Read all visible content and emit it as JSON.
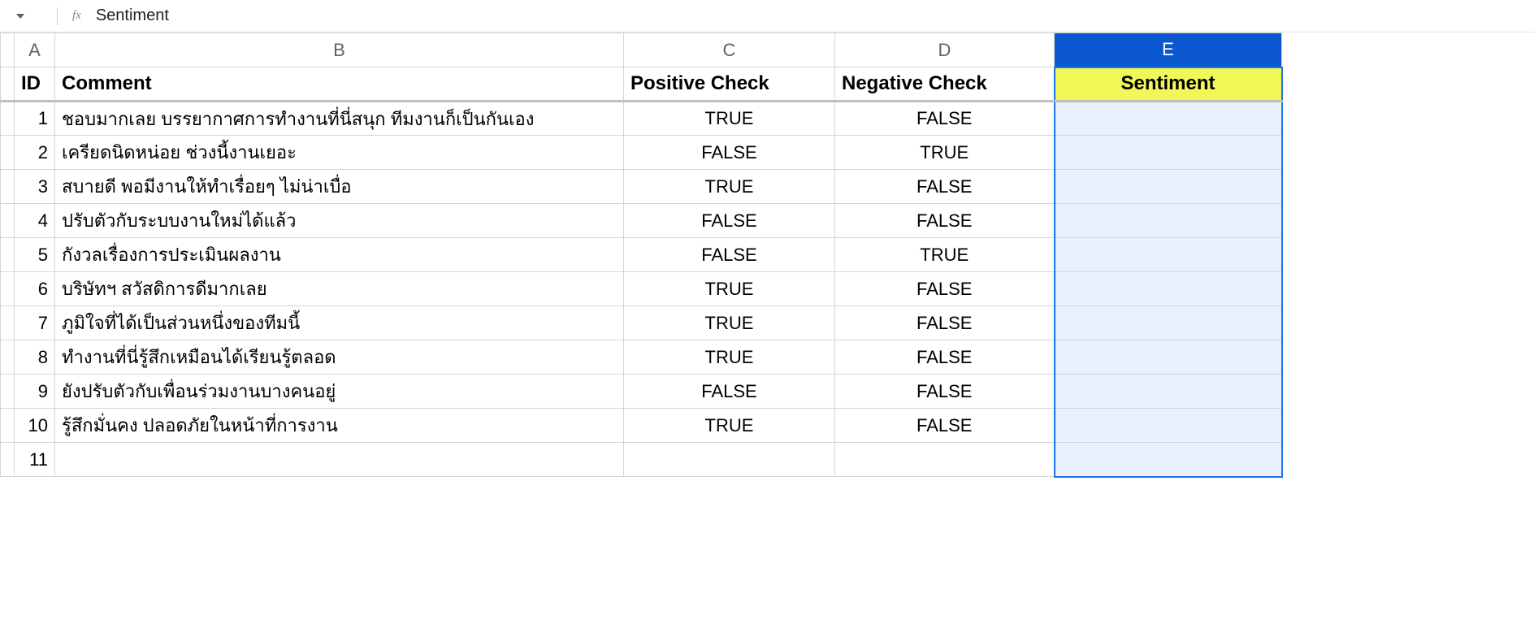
{
  "formula_bar": {
    "fx_label": "fx",
    "value": "Sentiment"
  },
  "columns": {
    "A": "A",
    "B": "B",
    "C": "C",
    "D": "D",
    "E": "E"
  },
  "headers": {
    "id": "ID",
    "comment": "Comment",
    "positive": "Positive Check",
    "negative": "Negative Check",
    "sentiment": "Sentiment"
  },
  "rows": [
    {
      "id": "1",
      "comment": "ชอบมากเลย บรรยากาศการทำงานที่นี่สนุก ทีมงานก็เป็นกันเอง",
      "pos": "TRUE",
      "neg": "FALSE",
      "sent": ""
    },
    {
      "id": "2",
      "comment": "เครียดนิดหน่อย ช่วงนี้งานเยอะ",
      "pos": "FALSE",
      "neg": "TRUE",
      "sent": ""
    },
    {
      "id": "3",
      "comment": "สบายดี พอมีงานให้ทำเรื่อยๆ ไม่น่าเบื่อ",
      "pos": "TRUE",
      "neg": "FALSE",
      "sent": ""
    },
    {
      "id": "4",
      "comment": "ปรับตัวกับระบบงานใหม่ได้แล้ว",
      "pos": "FALSE",
      "neg": "FALSE",
      "sent": ""
    },
    {
      "id": "5",
      "comment": "กังวลเรื่องการประเมินผลงาน",
      "pos": "FALSE",
      "neg": "TRUE",
      "sent": ""
    },
    {
      "id": "6",
      "comment": "บริษัทฯ สวัสดิการดีมากเลย",
      "pos": "TRUE",
      "neg": "FALSE",
      "sent": ""
    },
    {
      "id": "7",
      "comment": "ภูมิใจที่ได้เป็นส่วนหนึ่งของทีมนี้",
      "pos": "TRUE",
      "neg": "FALSE",
      "sent": ""
    },
    {
      "id": "8",
      "comment": "ทำงานที่นี่รู้สึกเหมือนได้เรียนรู้ตลอด",
      "pos": "TRUE",
      "neg": "FALSE",
      "sent": ""
    },
    {
      "id": "9",
      "comment": "ยังปรับตัวกับเพื่อนร่วมงานบางคนอยู่",
      "pos": "FALSE",
      "neg": "FALSE",
      "sent": ""
    },
    {
      "id": "10",
      "comment": "รู้สึกมั่นคง ปลอดภัยในหน้าที่การงาน",
      "pos": "TRUE",
      "neg": "FALSE",
      "sent": ""
    },
    {
      "id": "11",
      "comment": "",
      "pos": "",
      "neg": "",
      "sent": ""
    }
  ]
}
